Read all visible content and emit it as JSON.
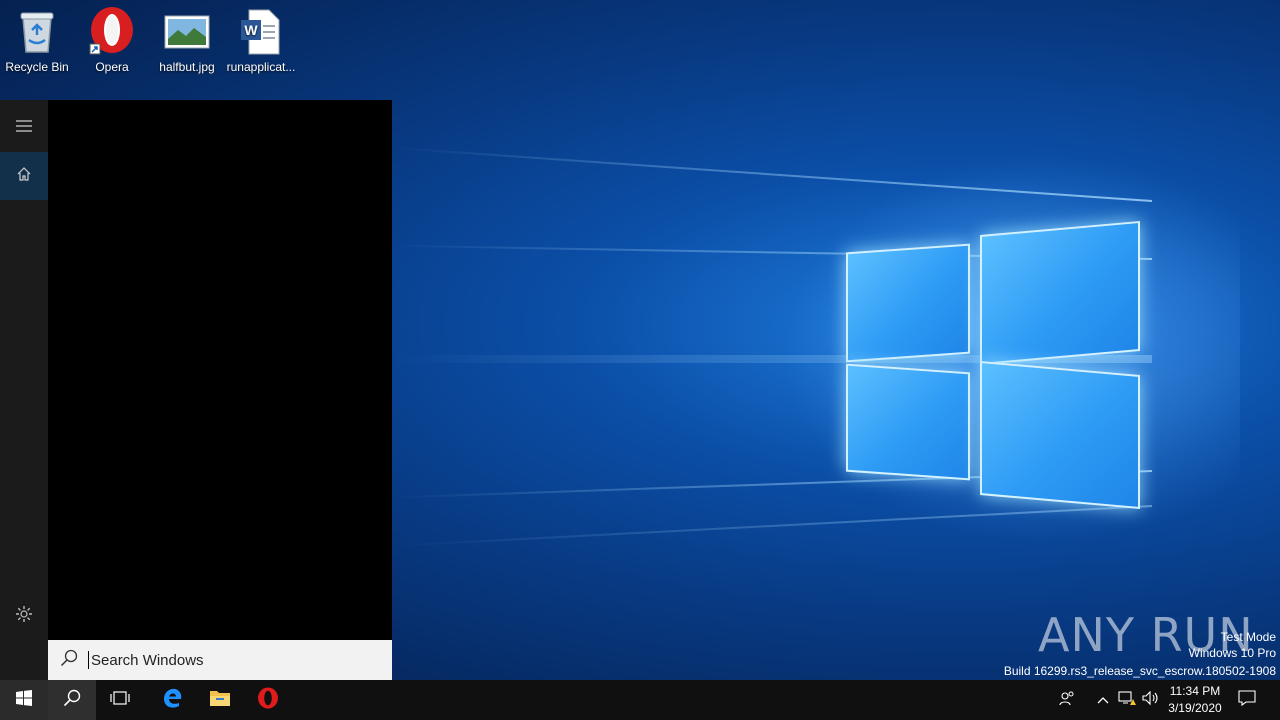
{
  "desktop": {
    "icons": [
      {
        "label": "Recycle Bin",
        "icon": "recycle-bin-icon"
      },
      {
        "label": "Opera",
        "icon": "opera-icon"
      },
      {
        "label": "halfbut.jpg",
        "icon": "image-file-icon"
      },
      {
        "label": "runapplicat...",
        "icon": "word-document-icon"
      }
    ]
  },
  "start_menu": {
    "rail": {
      "menu": "hamburger-icon",
      "home": "home-icon",
      "settings": "gear-icon"
    },
    "search": {
      "placeholder": "Search Windows",
      "icon": "search-icon"
    }
  },
  "watermark": {
    "brand": "ANY RUN",
    "line1": "Test Mode",
    "line2": "Windows 10 Pro",
    "line3": "Build 16299.rs3_release_svc_escrow.180502-1908"
  },
  "taskbar": {
    "pinned": [
      "start-windows-icon",
      "search-icon",
      "task-view-icon",
      "edge-icon",
      "file-explorer-icon",
      "opera-icon"
    ],
    "tray": [
      "people-icon",
      "chevron-up-icon",
      "network-warning-icon",
      "volume-icon",
      "notification-icon"
    ],
    "clock": {
      "time": "11:34 PM",
      "date": "3/19/2020"
    }
  },
  "colors": {
    "accent": "#0078d7",
    "wallpaper_dark": "#062a63",
    "taskbar": "#101010"
  }
}
